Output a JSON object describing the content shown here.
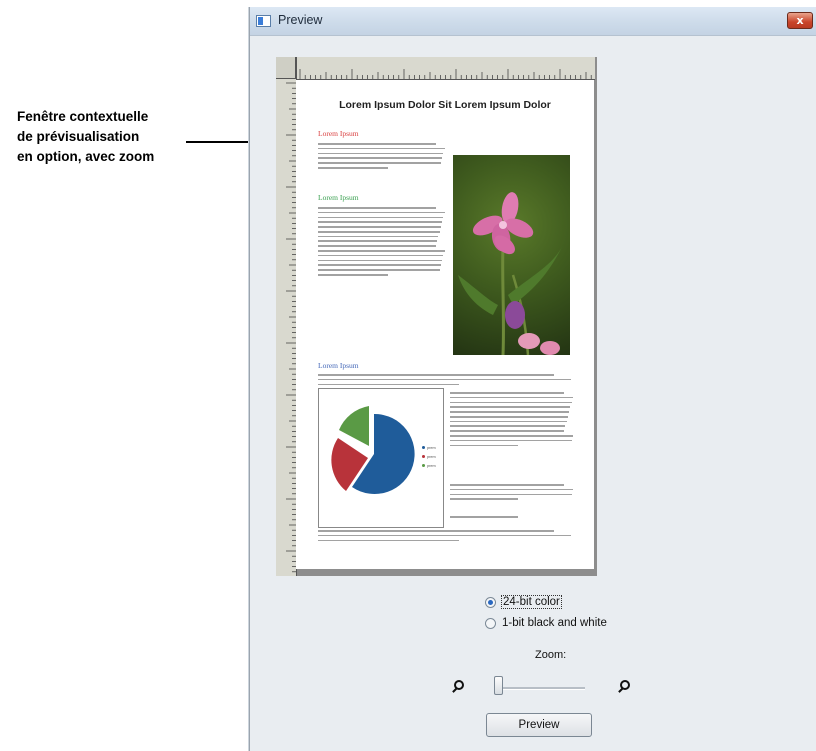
{
  "annotation": {
    "lines": [
      "Fenêtre contextuelle",
      "de prévisualisation",
      "en option, avec zoom"
    ]
  },
  "window": {
    "title": "Preview",
    "close_symbol": "x"
  },
  "document": {
    "title": "Lorem Ipsum Dolor Sit Lorem Ipsum Dolor",
    "headings": [
      "Lorem Ipsum",
      "Lorem Ipsum",
      "Lorem Ipsum"
    ],
    "chart_legend": [
      "prem",
      "prem",
      "prem"
    ]
  },
  "colors": {
    "heading_red": "#d94040",
    "heading_green": "#3aa050",
    "heading_blue": "#4468b8",
    "pie_blue": "#1f5c9a",
    "pie_red": "#b8333a",
    "pie_green": "#5a9a45"
  },
  "options": {
    "color_24bit": "24-bit color",
    "bw_1bit": "1-bit black and white",
    "selected": "24-bit color"
  },
  "zoom": {
    "label": "Zoom:",
    "level": 0,
    "zoom_out_icon": "magnifier-icon",
    "zoom_in_icon": "magnifier-icon"
  },
  "preview_button": "Preview"
}
